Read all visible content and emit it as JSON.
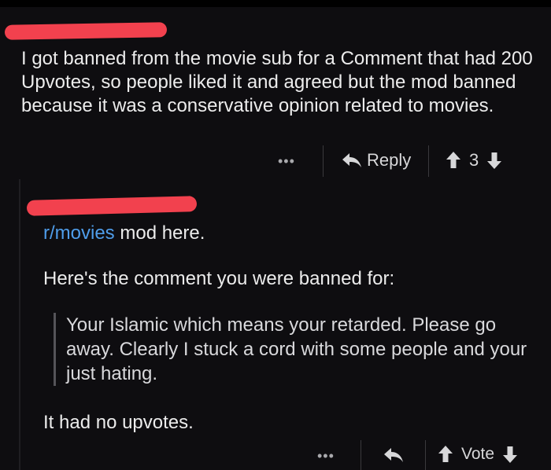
{
  "comment1": {
    "text": "I got banned from the movie sub for a Comment that had 200 Upvotes, so people liked it and agreed but the mod banned because it was a conservative opinion related to movies.",
    "more_label": "•••",
    "reply_label": "Reply",
    "score": "3"
  },
  "comment2": {
    "subreddit_link": "r/movies",
    "line1_rest": " mod here.",
    "line2": "Here's the comment you were banned for:",
    "quote": "Your Islamic which means your retarded. Please go away. Clearly I stuck a cord with some people and your just hating.",
    "line3": "It had no upvotes.",
    "more_label": "•••",
    "vote_label": "Vote"
  },
  "colors": {
    "background": "#0e0d10",
    "text": "#ececec",
    "link": "#4f9dea",
    "redaction": "#f2414e"
  }
}
